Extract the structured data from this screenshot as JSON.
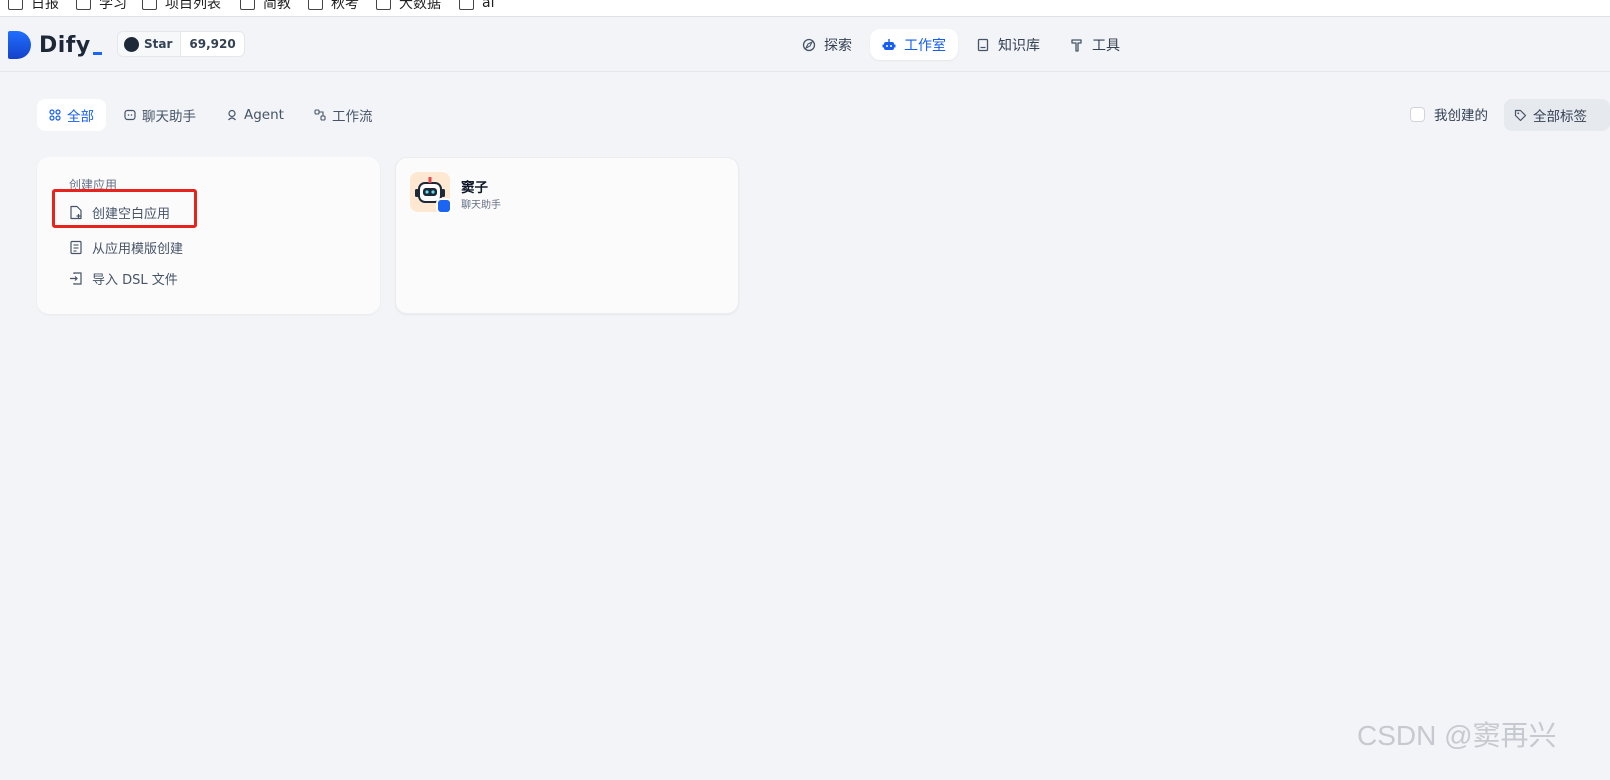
{
  "bookmarks": [
    {
      "label": "日报"
    },
    {
      "label": "学习"
    },
    {
      "label": "项目列表"
    },
    {
      "label": "简教"
    },
    {
      "label": "秋考"
    },
    {
      "label": "大数据"
    },
    {
      "label": "ai"
    }
  ],
  "header": {
    "logo_text": "Dify",
    "github": {
      "star_label": "Star",
      "count": "69,920"
    },
    "nav": [
      {
        "label": "探索",
        "icon": "compass-icon",
        "active": false
      },
      {
        "label": "工作室",
        "icon": "robot-icon",
        "active": true
      },
      {
        "label": "知识库",
        "icon": "book-icon",
        "active": false
      },
      {
        "label": "工具",
        "icon": "hammer-icon",
        "active": false
      }
    ]
  },
  "filters": {
    "tabs": [
      {
        "label": "全部",
        "active": true
      },
      {
        "label": "聊天助手",
        "active": false
      },
      {
        "label": "Agent",
        "active": false
      },
      {
        "label": "工作流",
        "active": false
      }
    ],
    "mine_label": "我创建的",
    "tag_label": "全部标签"
  },
  "create_card": {
    "title": "创建应用",
    "items": [
      {
        "label": "创建空白应用",
        "icon": "file-plus-icon"
      },
      {
        "label": "从应用模版创建",
        "icon": "template-icon"
      },
      {
        "label": "导入 DSL 文件",
        "icon": "import-icon"
      }
    ]
  },
  "apps": [
    {
      "name": "窦子",
      "type": "聊天助手",
      "icon": "robot-avatar-icon"
    }
  ],
  "watermark": "CSDN @窦再兴",
  "colors": {
    "accent": "#155eef",
    "highlight": "#e8221c",
    "background": "#f2f4f7"
  }
}
